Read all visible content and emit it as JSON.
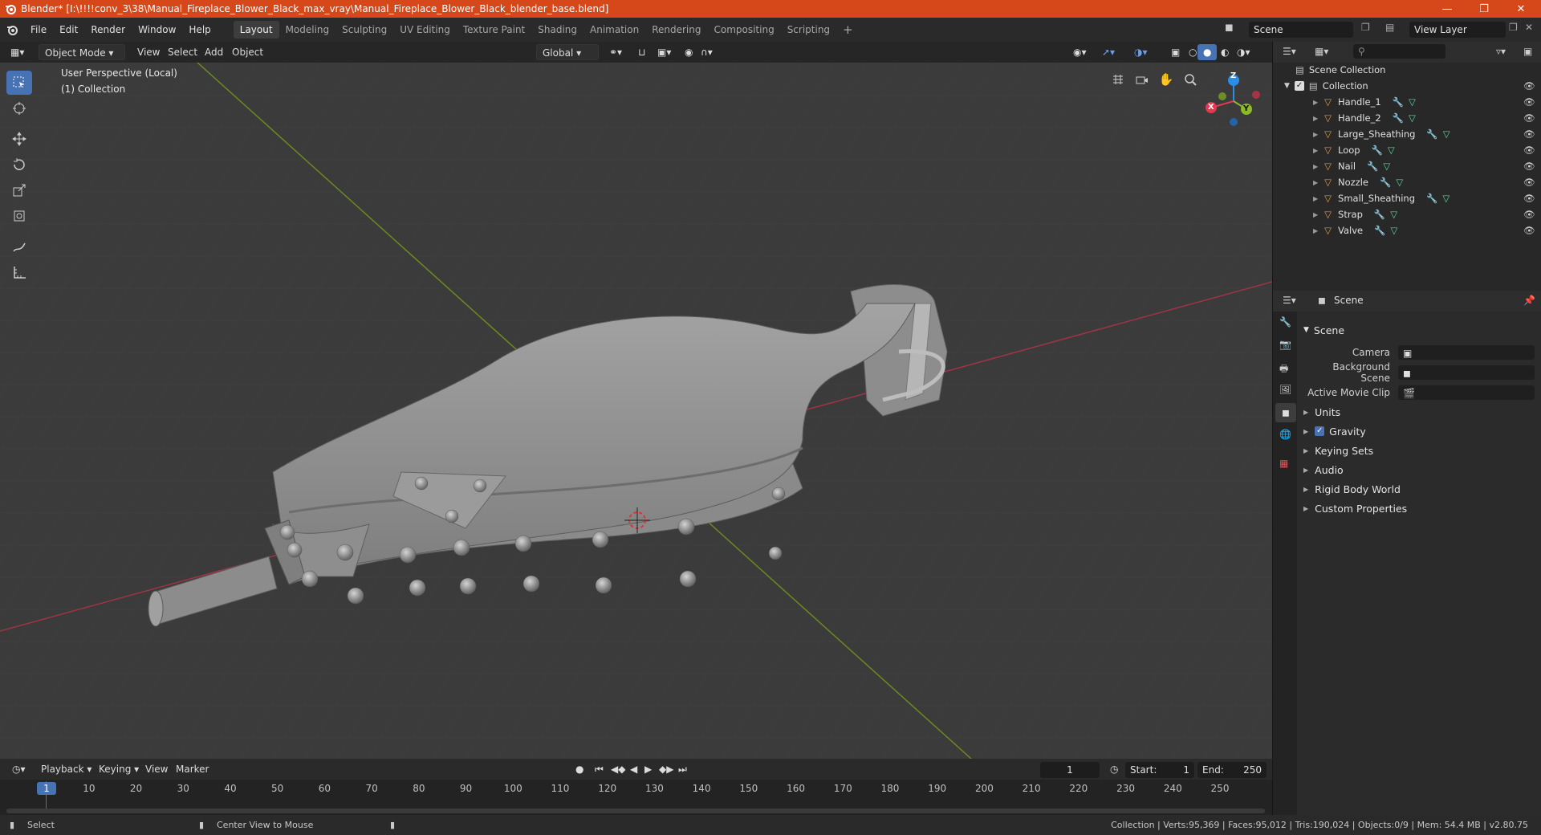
{
  "window": {
    "title": "Blender* [I:\\!!!!conv_3\\38\\Manual_Fireplace_Blower_Black_max_vray\\Manual_Fireplace_Blower_Black_blender_base.blend]"
  },
  "menus": [
    "File",
    "Edit",
    "Render",
    "Window",
    "Help"
  ],
  "workspace_tabs": [
    "Layout",
    "Modeling",
    "Sculpting",
    "UV Editing",
    "Texture Paint",
    "Shading",
    "Animation",
    "Rendering",
    "Compositing",
    "Scripting"
  ],
  "scene_field": "Scene",
  "view_layer_field": "View Layer",
  "viewport_header": {
    "mode": "Object Mode",
    "view": "View",
    "select": "Select",
    "add": "Add",
    "object": "Object",
    "orientation": "Global"
  },
  "viewport": {
    "perspective_label": "User Perspective (Local)",
    "collection_label": "(1) Collection",
    "gizmo_axes": [
      "Z",
      "X",
      "Y"
    ]
  },
  "outliner": {
    "root": "Scene Collection",
    "collection": "Collection",
    "objects": [
      "Handle_1",
      "Handle_2",
      "Large_Sheathing",
      "Loop",
      "Nail",
      "Nozzle",
      "Small_Sheathing",
      "Strap",
      "Valve"
    ]
  },
  "properties": {
    "context": "Scene",
    "panel_title": "Scene",
    "fields": [
      {
        "label": "Camera"
      },
      {
        "label": "Background Scene"
      },
      {
        "label": "Active Movie Clip"
      }
    ],
    "subpanels": [
      "Units",
      "Gravity",
      "Keying Sets",
      "Audio",
      "Rigid Body World",
      "Custom Properties"
    ],
    "gravity_checked": true
  },
  "timeline": {
    "menus": [
      "Playback",
      "Keying",
      "View",
      "Marker"
    ],
    "current_frame": "1",
    "start_label": "Start:",
    "start": "1",
    "end_label": "End:",
    "end": "250",
    "ticks": [
      "1",
      "10",
      "20",
      "30",
      "40",
      "50",
      "60",
      "70",
      "80",
      "90",
      "100",
      "110",
      "120",
      "130",
      "140",
      "150",
      "160",
      "170",
      "180",
      "190",
      "200",
      "210",
      "220",
      "230",
      "240",
      "250"
    ]
  },
  "statusbar": {
    "select": "Select",
    "center_view": "Center View to Mouse",
    "stats": "Collection | Verts:95,369 | Faces:95,012 | Tris:190,024 | Objects:0/9 | Mem: 54.4 MB | v2.80.75"
  },
  "colors": {
    "title_bar": "#d6481a",
    "active_tool": "#4772b3",
    "axis_x": "#e2394f",
    "axis_y": "#8cbb2a",
    "axis_z": "#2d8ce6",
    "object_icon": "#e89438",
    "mesh_icon": "#55d89a"
  }
}
